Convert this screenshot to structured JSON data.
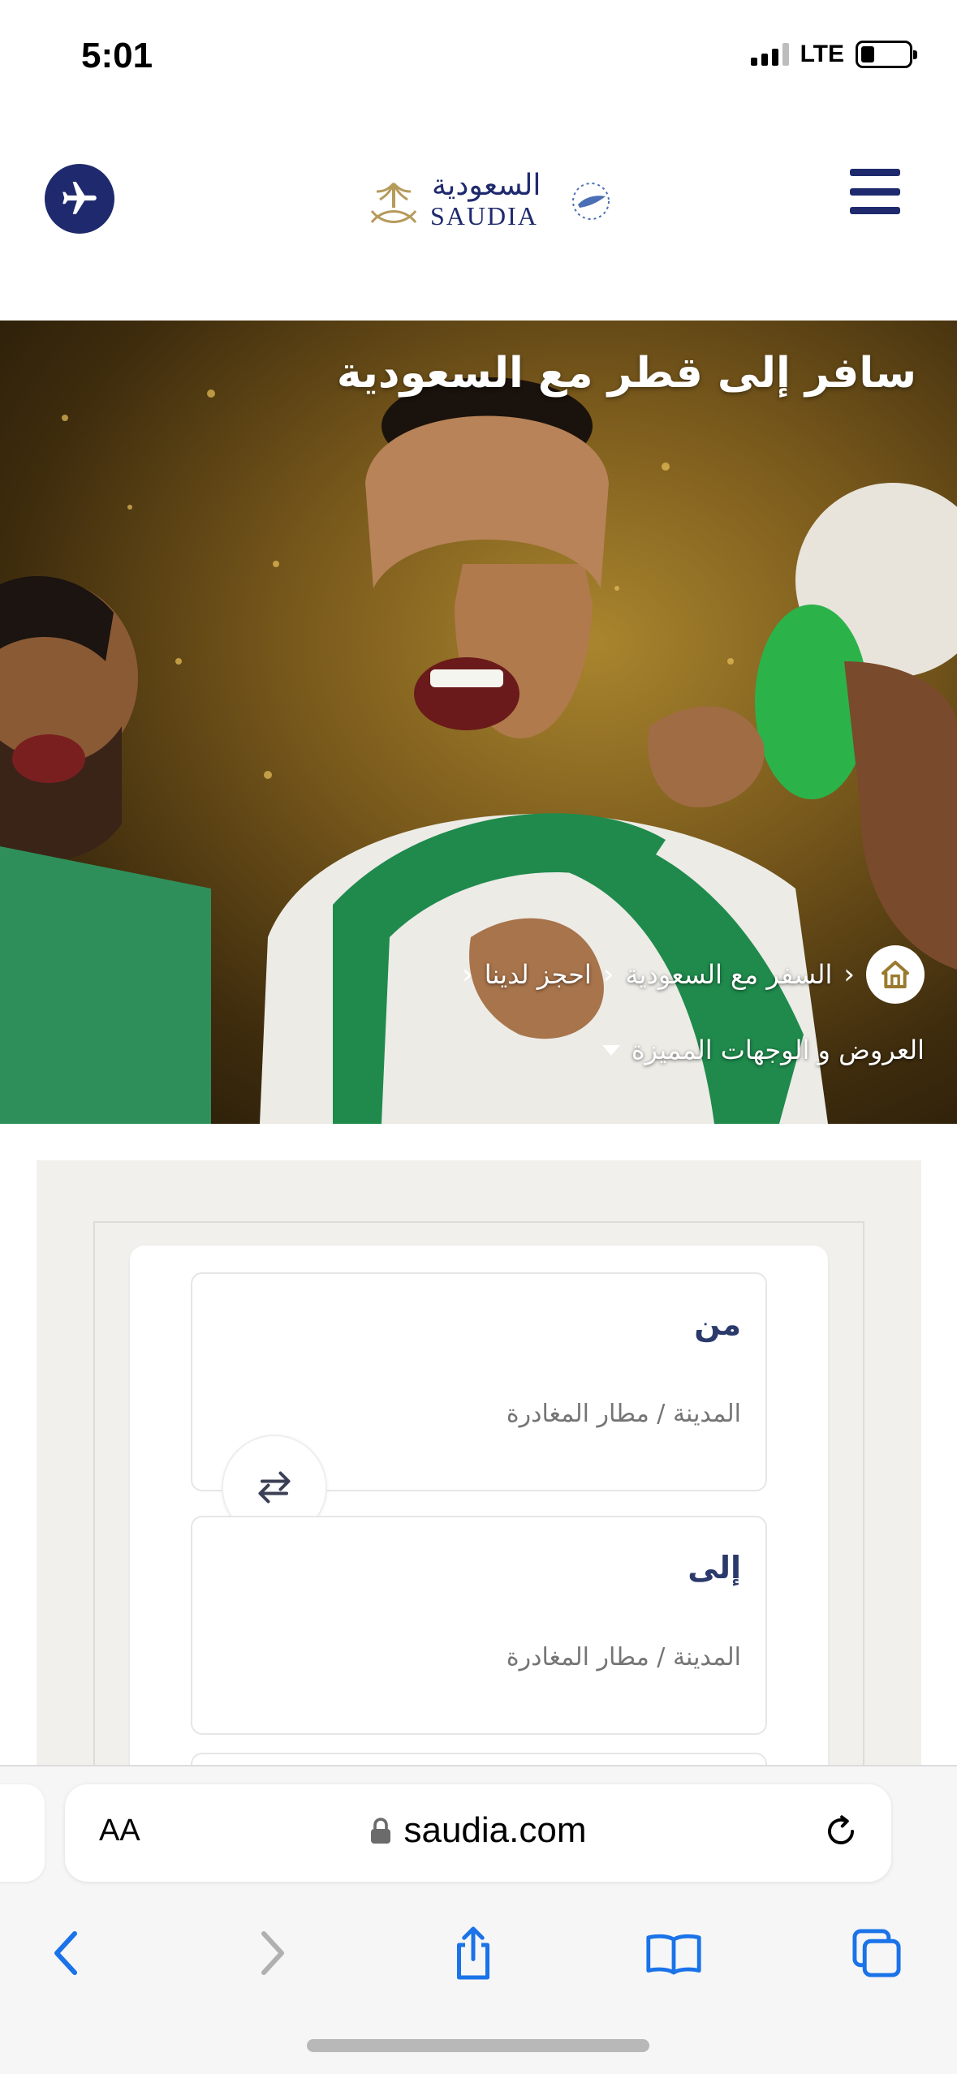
{
  "status_bar": {
    "time": "5:01",
    "network": "LTE",
    "battery_percent": 28
  },
  "header": {
    "logo_arabic": "السعودية",
    "logo_english": "SAUDIA",
    "icons": {
      "left": "airplane-icon",
      "right": "hamburger-menu-icon"
    }
  },
  "hero": {
    "title": "سافر إلى قطر مع السعودية",
    "breadcrumbs": [
      "السفر مع السعودية",
      "احجز لدينا"
    ],
    "dropdown_label": "العروض و الوجهات المميزة"
  },
  "booking": {
    "from": {
      "label": "من",
      "placeholder": "المدينة / مطار المغادرة"
    },
    "to": {
      "label": "إلى",
      "placeholder": "المدينة / مطار المغادرة"
    }
  },
  "browser": {
    "text_size_label": "AA",
    "url": "saudia.com",
    "toolbar_icons": [
      "back-icon",
      "forward-icon",
      "share-icon",
      "bookmarks-icon",
      "tabs-icon"
    ]
  },
  "colors": {
    "brand_navy": "#1f2a6e",
    "brand_gold": "#b59a5a",
    "booking_bg": "#f1f0ec"
  }
}
